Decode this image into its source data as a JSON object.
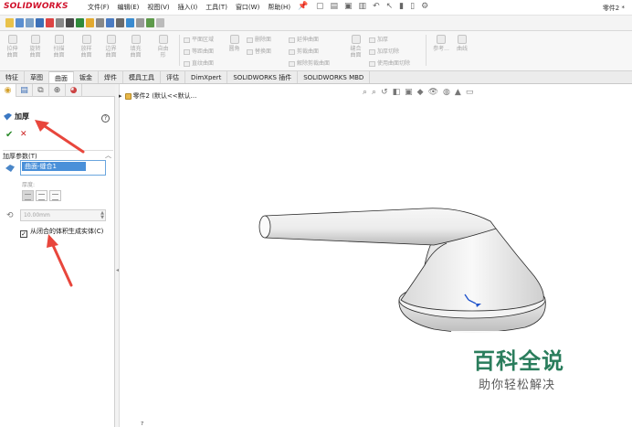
{
  "app": {
    "logo": "SOLIDWORKS",
    "menu": [
      "文件(F)",
      "编辑(E)",
      "视图(V)",
      "插入(I)",
      "工具(T)",
      "窗口(W)",
      "帮助(H)"
    ],
    "document_title": "零件2 *"
  },
  "ribbon": {
    "big_buttons": [
      {
        "label": "拉伸曲面"
      },
      {
        "label": "旋转曲面"
      },
      {
        "label": "扫描曲面"
      },
      {
        "label": "放样曲面"
      },
      {
        "label": "边界曲面"
      },
      {
        "label": "填充曲面"
      },
      {
        "label": "自由形"
      }
    ],
    "small_col1": [
      "平面区域",
      "等距曲面",
      "直纹曲面"
    ],
    "mid_button": "圆角",
    "small_col2": [
      "删除面",
      "替换面"
    ],
    "small_col3": [
      "延伸曲面",
      "剪裁曲面",
      "解除剪裁曲面"
    ],
    "knit_button": "缝合曲面",
    "small_col4": [
      "加厚",
      "加厚切除",
      "使用曲面切除"
    ],
    "ref_button": "参考...",
    "curve_button": "曲线"
  },
  "tabs": [
    "特征",
    "草图",
    "曲面",
    "钣金",
    "焊件",
    "模具工具",
    "评估",
    "DimXpert",
    "SOLIDWORKS 插件",
    "SOLIDWORKS MBD"
  ],
  "active_tab": "曲面",
  "property_manager": {
    "feature_title": "加厚",
    "help": "?",
    "ok": "✔",
    "cancel": "✕",
    "group_title": "加厚参数(T)",
    "selected_item": "曲面-缝合1",
    "thickness_label": "厚度:",
    "thickness_value": "10.00mm",
    "checkbox_checked": true,
    "checkbox_mark": "✓",
    "checkbox_label": "从闭合的体积生成实体(C)"
  },
  "viewport": {
    "tree_label": "零件2  (默认<<默认...",
    "corner_number": "7"
  },
  "watermark": {
    "title": "百科全说",
    "subtitle": "助你轻松解决"
  },
  "colors": {
    "accent": "#2a7d5c",
    "selection": "#4a90d9",
    "annotation_arrow": "#e8463c",
    "logo": "#d0112b"
  }
}
